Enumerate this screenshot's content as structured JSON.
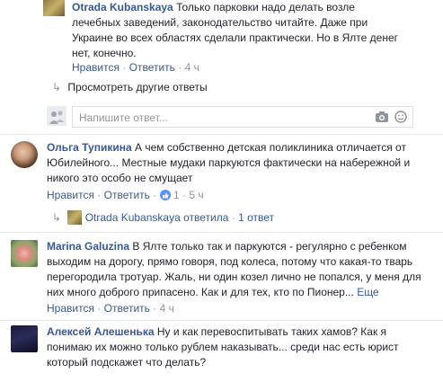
{
  "comments": [
    {
      "id": "c1",
      "author": "Otrada Kubanskaya",
      "lines": [
        "Только парковки надо делать возле",
        "лечебных заведений, законодательство читайте. Даже при",
        "Украине во всех областях сделали практически. Но в Ялте денег",
        "нет, конечно."
      ],
      "like": "Нравится",
      "reply": "Ответить",
      "time": "4 ч"
    },
    {
      "id": "c2",
      "author": "Ольга Тупикина",
      "lines": [
        "А чем собственно детская поликлиника отличается от",
        "Юбилейного... Местные мудаки паркуются фактически на набережной и",
        "никого это особо не смущает"
      ],
      "like": "Нравится",
      "reply": "Ответить",
      "likes_count": "1",
      "time": "5 ч"
    },
    {
      "id": "c3",
      "author": "Marina Galuzina",
      "lines": [
        "В Ялте только так и паркуются - регулярно с ребенком",
        "выходим на дорогу, прямо говоря, под колеса, потому что какая-то тварь",
        "перегородила тротуар. Жаль, ни один козел лично не попался, у меня для",
        "них много доброго припасено. Как и для тех, кто по Пионер..."
      ],
      "more": "Еще",
      "like": "Нравится",
      "reply": "Ответить",
      "time": "4 ч"
    },
    {
      "id": "c4",
      "author": "Алексей Алешенька",
      "lines": [
        "Ну и как перевоспитывать таких хамов? Как я",
        "понимаю их можно только рублем наказывать... среди нас есть юрист",
        "который подскажет что делать?"
      ]
    }
  ],
  "more_replies": "Просмотреть другие ответы",
  "reply_input_placeholder": "Напишите ответ...",
  "reply_summary": {
    "author": "Otrada Kubanskaya",
    "action": "ответила",
    "count": "1 ответ"
  },
  "colors": {
    "link": "#365899",
    "meta": "#90949c",
    "like_badge": "#5890ff"
  }
}
